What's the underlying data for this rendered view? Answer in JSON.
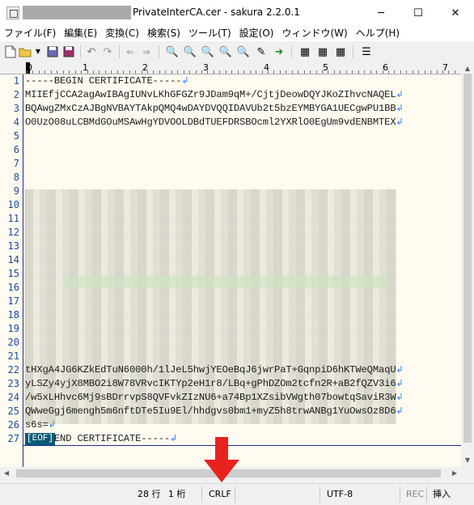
{
  "titlebar": {
    "title": "PrivateInterCA.cer - sakura 2.2.0.1",
    "minimize": "─",
    "maximize": "☐",
    "close": "✕"
  },
  "menu": [
    "ファイル(F)",
    "編集(E)",
    "変換(C)",
    "検索(S)",
    "ツール(T)",
    "設定(O)",
    "ウィンドウ(W)",
    "ヘルプ(H)"
  ],
  "ruler": [
    "0",
    "1",
    "2",
    "3",
    "4",
    "5",
    "6",
    "7"
  ],
  "lines": [
    {
      "n": "1",
      "text": "-----BEGIN CERTIFICATE-----"
    },
    {
      "n": "2",
      "text": "MIIEfjCCA2agAwIBAgIUNvLKhGFGZr9JDam9qM+/CjtjDeowDQYJKoZIhvcNAQEL"
    },
    {
      "n": "3",
      "text": "BQAwgZMxCzAJBgNVBAYTAkpQMQ4wDAYDVQQIDAVUb2t5bzEYMBYGA1UECgwPU1BB"
    },
    {
      "n": "4",
      "text": "O0UzO08uLCBMdGOuMSAwHgYDVOOLDBdTUEFDRSBOcml2YXRlO0EgUm9vdENBMTEX"
    },
    {
      "n": "5",
      "text": ""
    },
    {
      "n": "6",
      "text": ""
    },
    {
      "n": "7",
      "text": ""
    },
    {
      "n": "8",
      "text": ""
    },
    {
      "n": "9",
      "text": ""
    },
    {
      "n": "10",
      "text": ""
    },
    {
      "n": "11",
      "text": ""
    },
    {
      "n": "12",
      "text": ""
    },
    {
      "n": "13",
      "text": ""
    },
    {
      "n": "14",
      "text": ""
    },
    {
      "n": "15",
      "text": ""
    },
    {
      "n": "16",
      "text": ""
    },
    {
      "n": "17",
      "text": ""
    },
    {
      "n": "18",
      "text": ""
    },
    {
      "n": "19",
      "text": ""
    },
    {
      "n": "20",
      "text": ""
    },
    {
      "n": "21",
      "text": ""
    },
    {
      "n": "22",
      "text": "tHXgA4JG6KZkEdTuN6000h/1lJeL5hwjYEOeBqJ6jwrPaT+GqnpiD6hKTWeQMaqU"
    },
    {
      "n": "23",
      "text": "yLSZy4yjX8MBO2i8W78VRvcIKTYp2eH1r8/LBq+gPhDZOm2tcfn2R+aB2fQZV3i6"
    },
    {
      "n": "24",
      "text": "/w5xLHhvc6Mj9sBDrrvpS8QVFvkZIzNU6+a74Bp1XZsibVWgth07bowtqSaviR3W"
    },
    {
      "n": "25",
      "text": "QWweGgj6mengh5m6nftDTe5Iu9El/hhdgvs0bm1+myZ5h8trwANBg1YuOwsOz8D6"
    },
    {
      "n": "26",
      "text": "s6s="
    },
    {
      "n": "27",
      "text": "-----END CERTIFICATE-----"
    }
  ],
  "eol_mark": "↲",
  "eof_label": "[EOF]",
  "status": {
    "line": "28 行",
    "col": "1 桁",
    "eol": "CRLF",
    "encoding": "UTF-8",
    "rec": "REC",
    "insert": "挿入"
  },
  "colors": {
    "line_numbers": "#1a4ea0",
    "eol_mark": "#2080ff",
    "eof_bg": "#0a5a76",
    "annotation_arrow": "#e8231f"
  }
}
